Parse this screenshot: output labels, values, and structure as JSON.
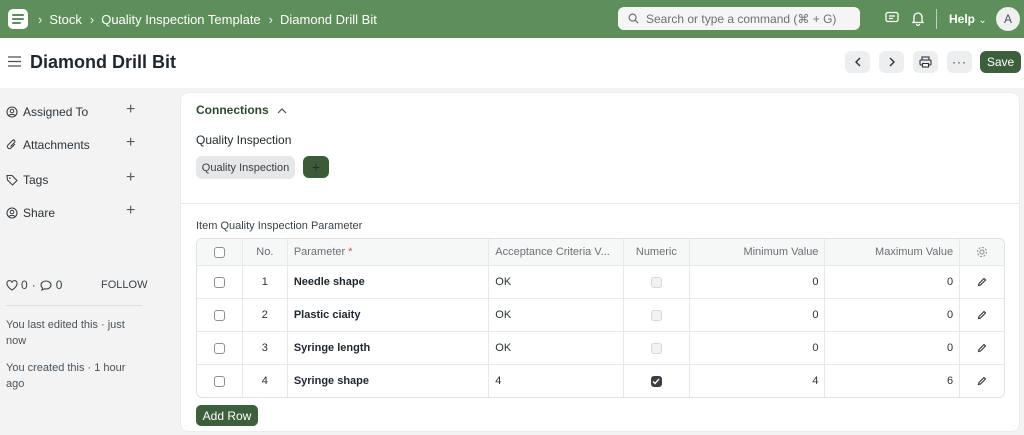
{
  "navbar": {
    "breadcrumbs": [
      "Stock",
      "Quality Inspection Template",
      "Diamond Drill Bit"
    ],
    "search_placeholder": "Search or type a command (⌘ + G)",
    "help_label": "Help",
    "avatar_initial": "A"
  },
  "page": {
    "title": "Diamond Drill Bit",
    "save_label": "Save"
  },
  "sidebar": {
    "items": [
      {
        "label": "Assigned To",
        "icon": "user-assign-icon"
      },
      {
        "label": "Attachments",
        "icon": "paperclip-icon"
      },
      {
        "label": "Tags",
        "icon": "tag-icon"
      },
      {
        "label": "Share",
        "icon": "share-user-icon"
      }
    ],
    "likes": "0",
    "comments": "0",
    "dot": "·",
    "follow_label": "FOLLOW",
    "activity": [
      "You last edited this · just now",
      "You created this · 1 hour ago"
    ]
  },
  "connections": {
    "title": "Connections",
    "group_label": "Quality Inspection",
    "pill_label": "Quality Inspection",
    "add_label": "+"
  },
  "table": {
    "title": "Item Quality Inspection Parameter",
    "headers": {
      "no": "No.",
      "parameter": "Parameter",
      "required_mark": "*",
      "acceptance": "Acceptance Criteria V...",
      "numeric": "Numeric",
      "min": "Minimum Value",
      "max": "Maximum Value"
    },
    "rows": [
      {
        "no": "1",
        "parameter": "Needle shape",
        "acceptance": "OK",
        "numeric": false,
        "min": "0",
        "max": "0"
      },
      {
        "no": "2",
        "parameter": "Plastic ciaity",
        "acceptance": "OK",
        "numeric": false,
        "min": "0",
        "max": "0"
      },
      {
        "no": "3",
        "parameter": "Syringe length",
        "acceptance": "OK",
        "numeric": false,
        "min": "0",
        "max": "0"
      },
      {
        "no": "4",
        "parameter": "Syringe shape",
        "acceptance": "4",
        "numeric": true,
        "min": "4",
        "max": "6"
      }
    ],
    "add_row_label": "Add Row"
  },
  "colors": {
    "navbar": "#5e8f5a",
    "primary_button": "#3d5f3b"
  }
}
